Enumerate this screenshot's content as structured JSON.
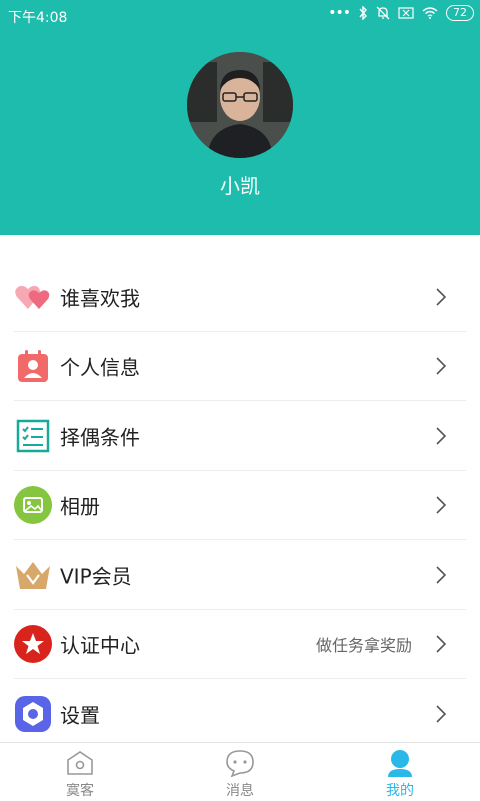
{
  "status_bar": {
    "time": "下午4:08",
    "battery": "72"
  },
  "profile": {
    "name": "小凯"
  },
  "menu": [
    {
      "label": "谁喜欢我",
      "hint": ""
    },
    {
      "label": "个人信息",
      "hint": ""
    },
    {
      "label": "择偶条件",
      "hint": ""
    },
    {
      "label": "相册",
      "hint": ""
    },
    {
      "label": "VIP会员",
      "hint": ""
    },
    {
      "label": "认证中心",
      "hint": "做任务拿奖励"
    },
    {
      "label": "设置",
      "hint": ""
    }
  ],
  "tabs": [
    {
      "label": "寞客",
      "icon": "home-icon",
      "active": false
    },
    {
      "label": "消息",
      "icon": "chat-icon",
      "active": false
    },
    {
      "label": "我的",
      "icon": "person-icon",
      "active": true
    }
  ],
  "colors": {
    "header": "#1dbcac",
    "active_tab": "#29b8e8"
  }
}
